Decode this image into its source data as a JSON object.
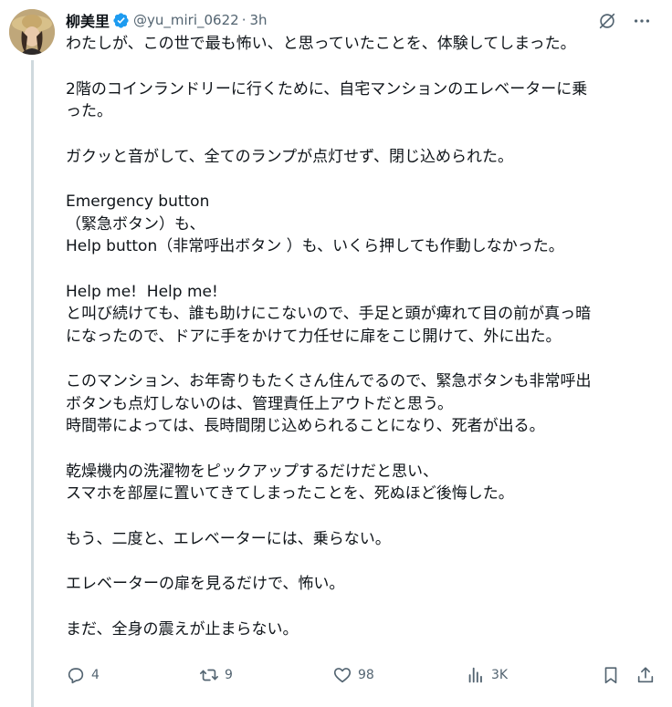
{
  "author": {
    "name": "柳美里",
    "handle": "@yu_miri_0622",
    "separator": "·",
    "time": "3h"
  },
  "tweet": {
    "paragraphs": [
      "わたしが、この世で最も怖い、と思っていたことを、体験してしまった。",
      "2階のコインランドリーに行くために、自宅マンションのエレベーターに乗\nった。",
      "ガクッと音がして、全てのランプが点灯せず、閉じ込められた。",
      "Emergency button\n（緊急ボタン）も、\nHelp button（非常呼出ボタン ）も、いくら押しても作動しなかった。",
      "Help me!  Help me!\nと叫び続けても、誰も助けにこないので、手足と頭が痺れて目の前が真っ暗\nになったので、ドアに手をかけて力任せに扉をこじ開けて、外に出た。",
      "このマンション、お年寄りもたくさん住んでるので、緊急ボタンも非常呼出\nボタンも点灯しないのは、管理責任上アウトだと思う。\n時間帯によっては、長時間閉じ込められることになり、死者が出る。",
      "乾燥機内の洗濯物をピックアップするだけだと思い、\nスマホを部屋に置いてきてしまったことを、死ぬほど後悔した。",
      "もう、二度と、エレベーターには、乗らない。",
      "エレベーターの扉を見るだけで、怖い。",
      "まだ、全身の震えが止まらない。"
    ]
  },
  "actions": {
    "reply_count": "4",
    "retweet_count": "9",
    "like_count": "98",
    "views_count": "3K"
  },
  "icons": {
    "verified": "verified-badge-icon",
    "grok": "grok-icon",
    "more": "more-icon",
    "reply": "reply-icon",
    "retweet": "retweet-icon",
    "like": "like-icon",
    "views": "views-icon",
    "bookmark": "bookmark-icon",
    "share": "share-icon"
  },
  "colors": {
    "verified": "#1d9bf0",
    "muted": "#536471",
    "text": "#0f1419"
  }
}
